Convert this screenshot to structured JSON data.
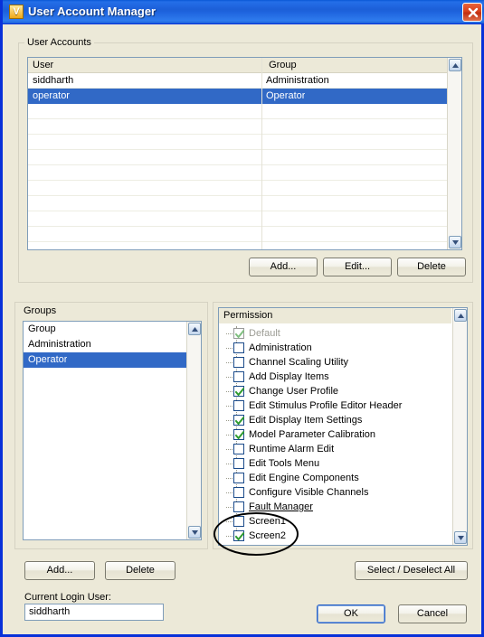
{
  "window": {
    "title": "User Account Manager",
    "icon": "app-v-icon",
    "icon_letter": "V",
    "close_label": "Close",
    "frame_color": "#0831D9",
    "dialog_bg": "#ECE9D8",
    "selection_color": "#3169C6"
  },
  "user_accounts": {
    "group_label": "User Accounts",
    "columns": [
      "User",
      "Group"
    ],
    "rows": [
      {
        "user": "siddharth",
        "group": "Administration",
        "selected": false
      },
      {
        "user": "operator",
        "group": "Operator",
        "selected": true
      }
    ],
    "empty_rows": 10,
    "buttons": {
      "add": "Add...",
      "edit": "Edit...",
      "delete": "Delete"
    }
  },
  "groups": {
    "group_label": "Groups",
    "header": "Group",
    "rows": [
      {
        "name": "Administration",
        "selected": false
      },
      {
        "name": "Operator",
        "selected": true
      }
    ],
    "buttons": {
      "add": "Add...",
      "delete": "Delete"
    }
  },
  "permission": {
    "group_label": "Permission",
    "items": [
      {
        "label": "Default",
        "checked": true,
        "disabled": true,
        "underline": false
      },
      {
        "label": "Administration",
        "checked": false,
        "disabled": false,
        "underline": false
      },
      {
        "label": "Channel Scaling Utility",
        "checked": false,
        "disabled": false,
        "underline": false
      },
      {
        "label": "Add Display Items",
        "checked": false,
        "disabled": false,
        "underline": false
      },
      {
        "label": "Change User Profile",
        "checked": true,
        "disabled": false,
        "underline": false
      },
      {
        "label": "Edit Stimulus Profile Editor Header",
        "checked": false,
        "disabled": false,
        "underline": false
      },
      {
        "label": "Edit Display Item Settings",
        "checked": true,
        "disabled": false,
        "underline": false
      },
      {
        "label": "Model Parameter Calibration",
        "checked": true,
        "disabled": false,
        "underline": false
      },
      {
        "label": "Runtime Alarm Edit",
        "checked": false,
        "disabled": false,
        "underline": false
      },
      {
        "label": "Edit Tools Menu",
        "checked": false,
        "disabled": false,
        "underline": false
      },
      {
        "label": "Edit Engine Components",
        "checked": false,
        "disabled": false,
        "underline": false
      },
      {
        "label": "Configure Visible Channels",
        "checked": false,
        "disabled": false,
        "underline": false
      },
      {
        "label": "Fault Manager",
        "checked": false,
        "disabled": false,
        "underline": true
      },
      {
        "label": "Screen1",
        "checked": false,
        "disabled": false,
        "underline": false
      },
      {
        "label": "Screen2",
        "checked": true,
        "disabled": false,
        "underline": false
      }
    ],
    "select_deselect_button": "Select / Deselect All",
    "checkmark_color": "#2E9B2E"
  },
  "footer": {
    "current_login_label": "Current Login User:",
    "current_login_value": "siddharth",
    "ok": "OK",
    "cancel": "Cancel"
  },
  "annotation": {
    "type": "hand-drawn-ellipse",
    "encircles": [
      "Screen1",
      "Screen2"
    ],
    "color": "#000000"
  }
}
